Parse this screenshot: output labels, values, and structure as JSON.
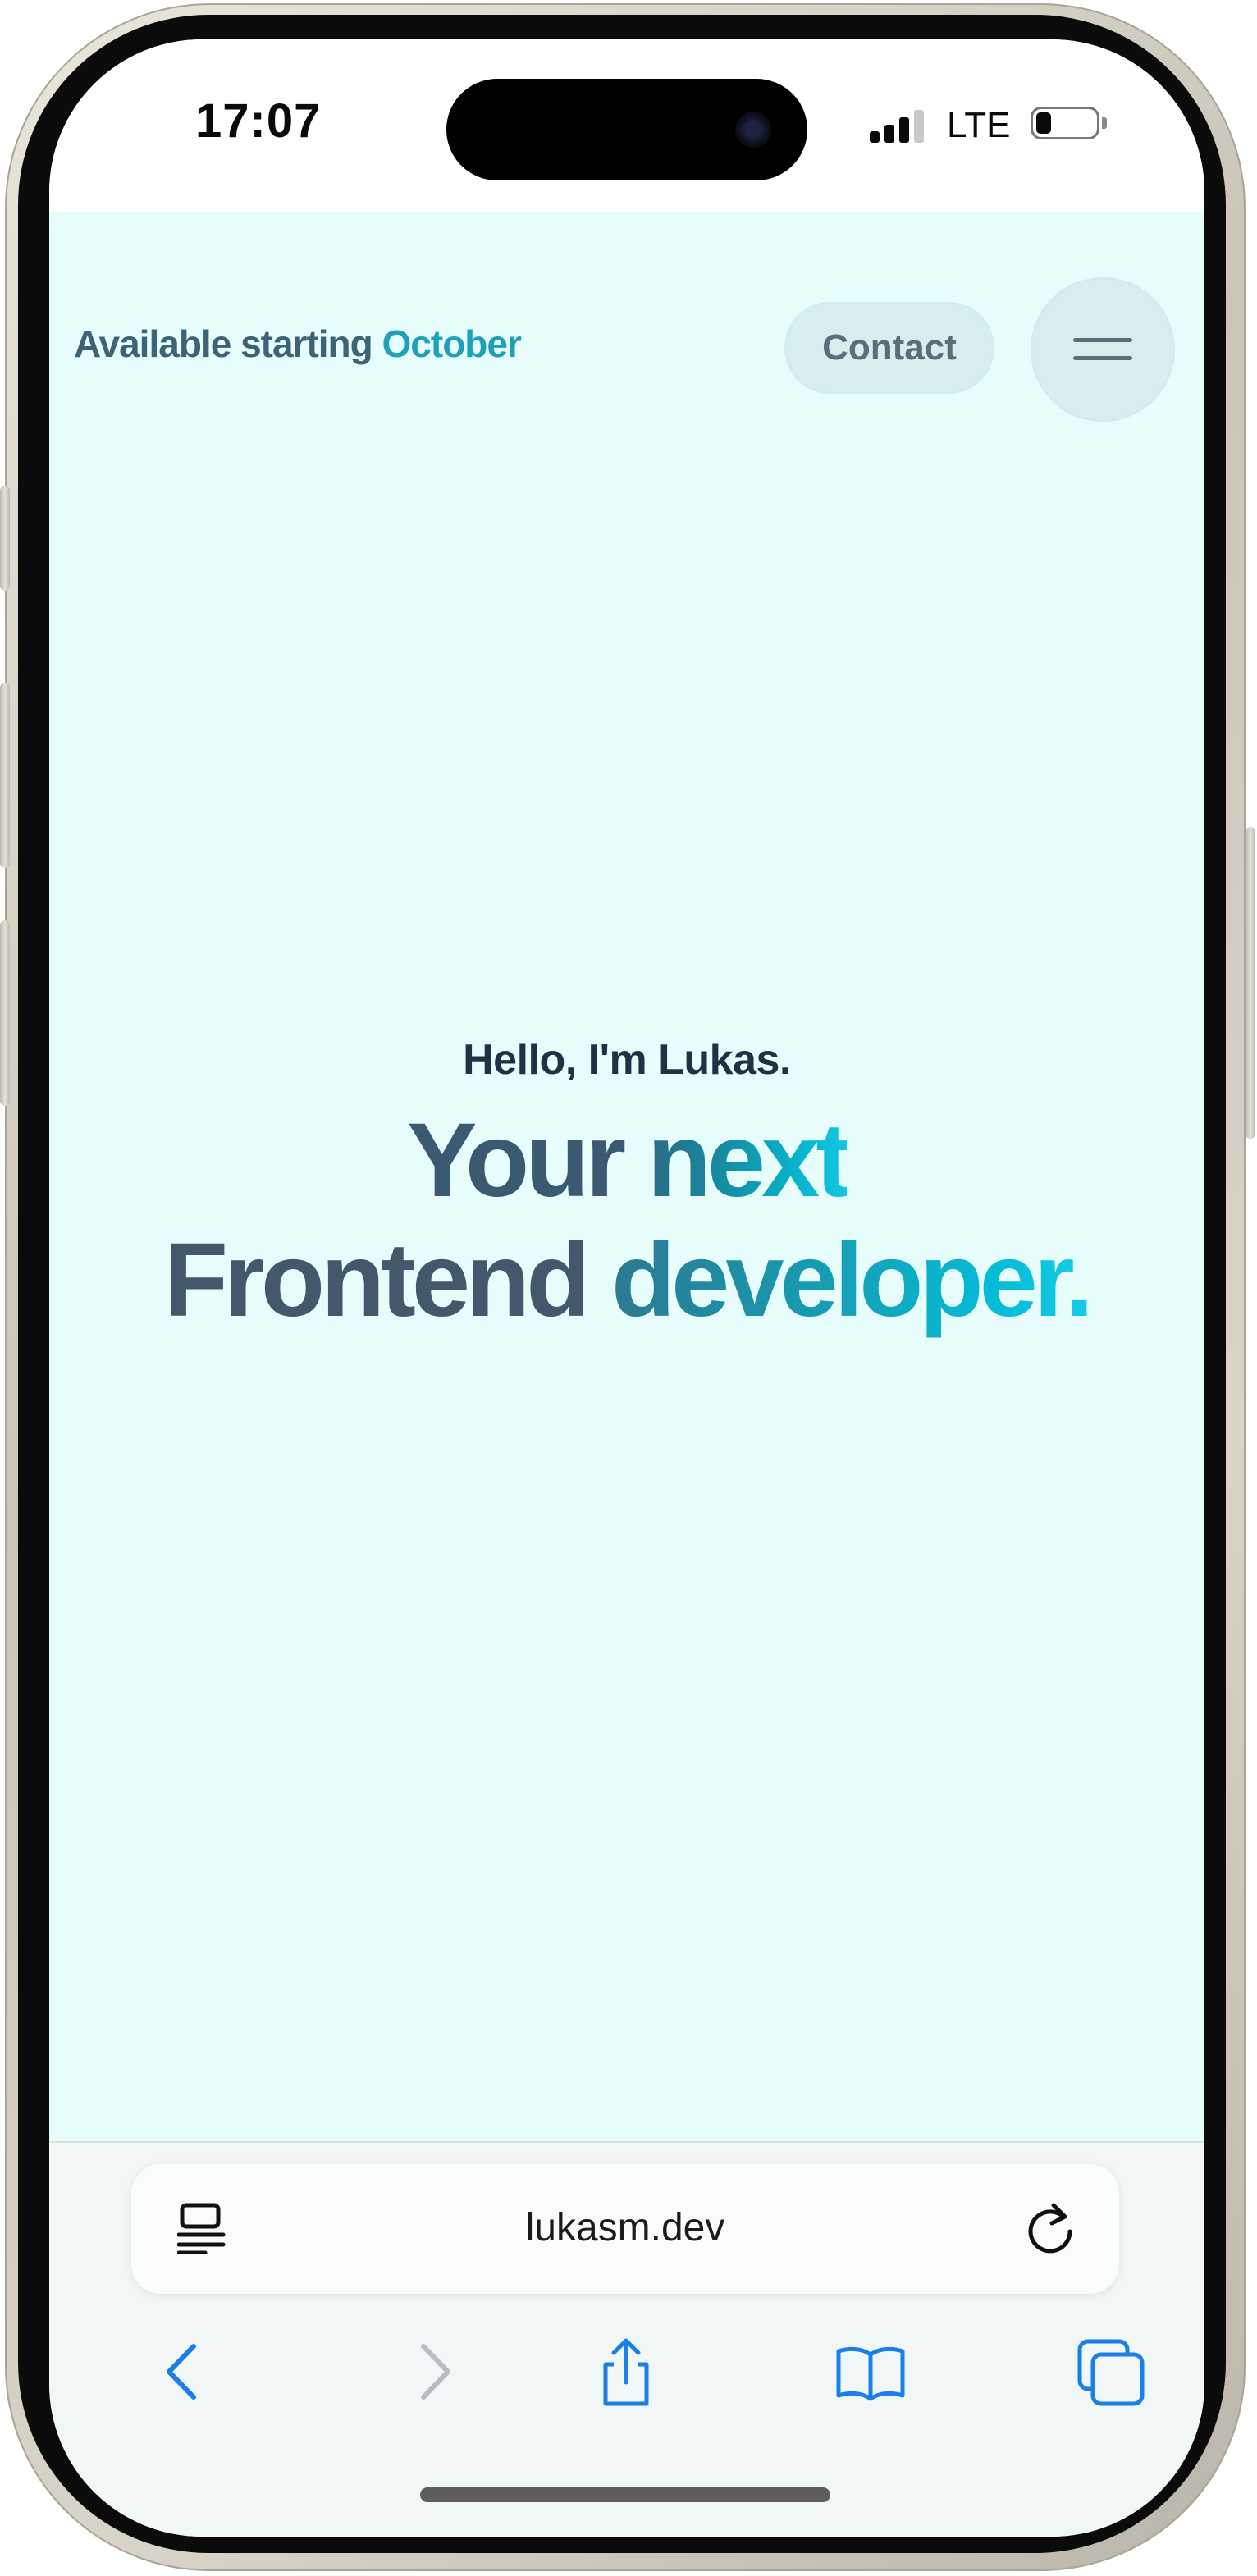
{
  "status_bar": {
    "time": "17:07",
    "network": "LTE",
    "signal_bars": 3,
    "battery_level": 0.2
  },
  "header": {
    "availability_prefix": "Available starting",
    "availability_month": "October",
    "contact_label": "Contact",
    "menu_icon": "hamburger-icon"
  },
  "hero": {
    "greeting": "Hello, I'm Lukas.",
    "line1_a": "Your",
    "line1_b": "next",
    "line2_a": "Frontend",
    "line2_b": "developer."
  },
  "browser": {
    "url": "lukasm.dev",
    "reader_icon": "reader-mode-icon",
    "reload_icon": "reload-icon",
    "nav": [
      "back-icon",
      "forward-icon",
      "share-icon",
      "bookmarks-icon",
      "tabs-icon"
    ]
  },
  "colors": {
    "page_background": "#e6fdfb",
    "accent_cyan": "#07b4cc",
    "accent_teal": "#1da0b8",
    "dark_slate": "#3a5a72",
    "ios_blue": "#1a7fe8"
  }
}
